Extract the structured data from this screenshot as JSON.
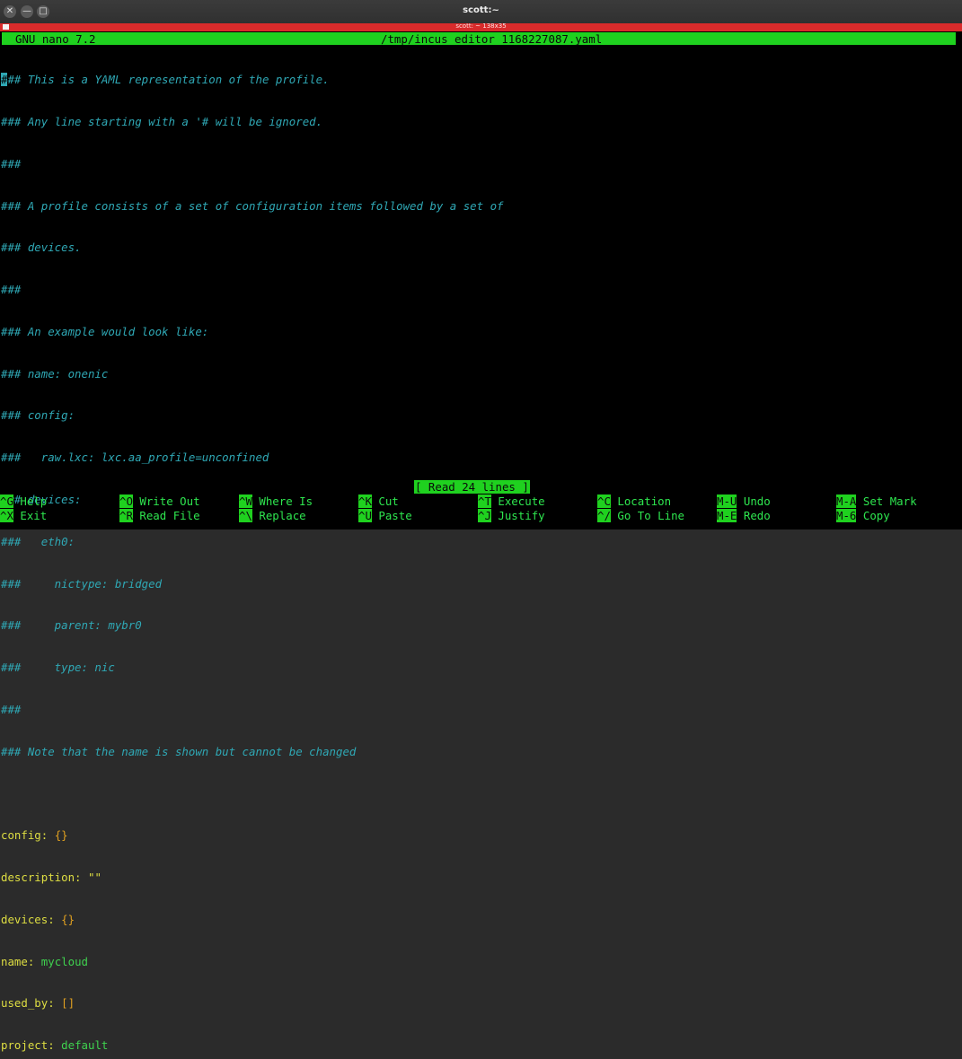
{
  "window": {
    "title": "scott:~",
    "tab_label": "scott: ~ 138x35",
    "close_glyph": "✕",
    "minimize_glyph": "—",
    "maximize_glyph": "□"
  },
  "nano": {
    "version": "GNU nano 7.2",
    "filename": "/tmp/incus_editor_1168227087.yaml"
  },
  "comments": [
    "### This is a YAML representation of the profile.",
    "### Any line starting with a '# will be ignored.",
    "###",
    "### A profile consists of a set of configuration items followed by a set of",
    "### devices.",
    "###",
    "### An example would look like:",
    "### name: onenic",
    "### config:",
    "###   raw.lxc: lxc.aa_profile=unconfined",
    "### devices:",
    "###   eth0:",
    "###     nictype: bridged",
    "###     parent: mybr0",
    "###     type: nic",
    "###",
    "### Note that the name is shown but cannot be changed"
  ],
  "yaml": {
    "config_key": "config:",
    "config_value": "{}",
    "description_key": "description:",
    "description_value": "\"\"",
    "devices_key": "devices:",
    "devices_value": "{}",
    "name_key": "name:",
    "name_value": "mycloud",
    "used_by_key": "used_by:",
    "used_by_value": "[]",
    "project_key": "project:",
    "project_value": "default"
  },
  "status": "[ Read 24 lines ]",
  "shortcuts": [
    {
      "key": "^G",
      "label": "Help"
    },
    {
      "key": "^X",
      "label": "Exit"
    },
    {
      "key": "^O",
      "label": "Write Out"
    },
    {
      "key": "^R",
      "label": "Read File"
    },
    {
      "key": "^W",
      "label": "Where Is"
    },
    {
      "key": "^\\",
      "label": "Replace"
    },
    {
      "key": "^K",
      "label": "Cut"
    },
    {
      "key": "^U",
      "label": "Paste"
    },
    {
      "key": "^T",
      "label": "Execute"
    },
    {
      "key": "^J",
      "label": "Justify"
    },
    {
      "key": "^C",
      "label": "Location"
    },
    {
      "key": "^/",
      "label": "Go To Line"
    },
    {
      "key": "M-U",
      "label": "Undo"
    },
    {
      "key": "M-E",
      "label": "Redo"
    },
    {
      "key": "M-A",
      "label": "Set Mark"
    },
    {
      "key": "M-6",
      "label": "Copy"
    }
  ]
}
